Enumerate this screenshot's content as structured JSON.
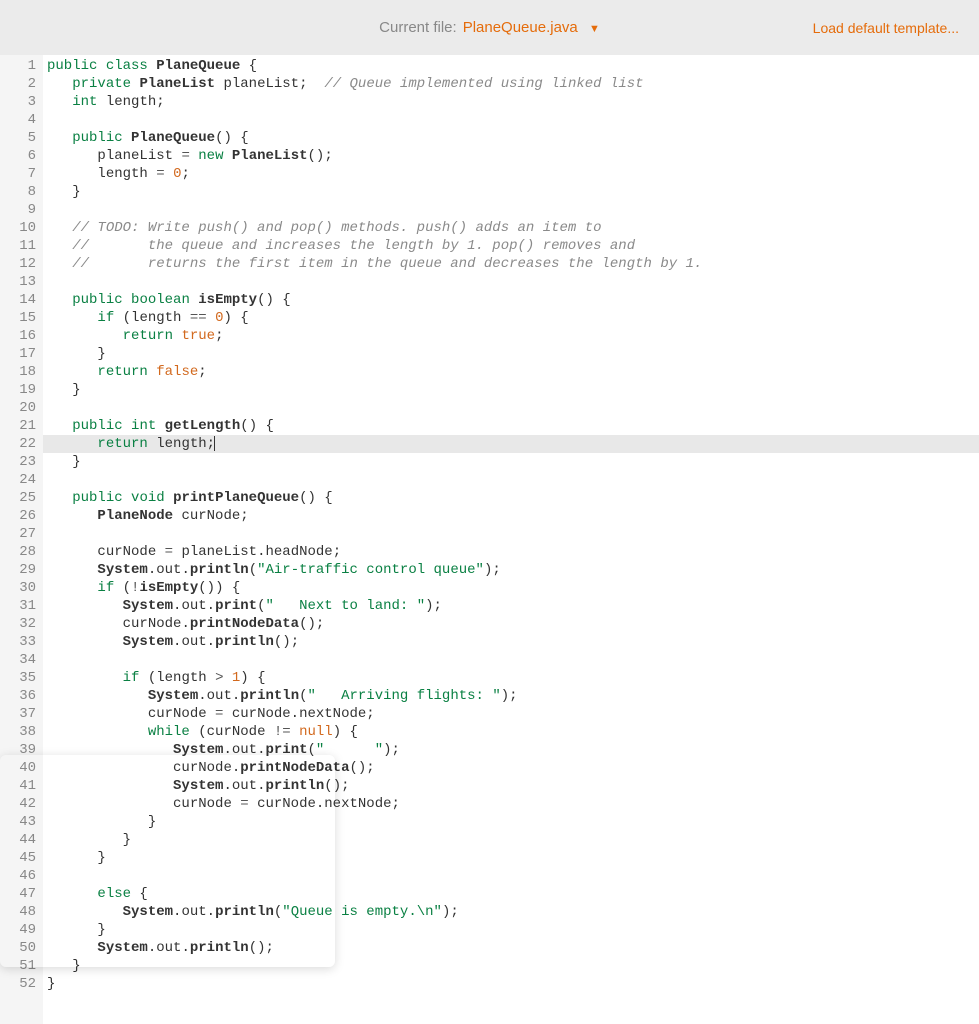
{
  "header": {
    "current_file_label": "Current file:",
    "filename": "PlaneQueue.java",
    "load_default": "Load default template..."
  },
  "active_line": 22,
  "lines": [
    [
      [
        "k-public",
        "public"
      ],
      [
        "text",
        " "
      ],
      [
        "k-class",
        "class"
      ],
      [
        "text",
        " "
      ],
      [
        "cls",
        "PlaneQueue"
      ],
      [
        "text",
        " {"
      ]
    ],
    [
      [
        "text",
        "   "
      ],
      [
        "k-private",
        "private"
      ],
      [
        "text",
        " "
      ],
      [
        "cls",
        "PlaneList"
      ],
      [
        "text",
        " "
      ],
      [
        "prop",
        "planeList"
      ],
      [
        "text",
        ";  "
      ],
      [
        "cmt",
        "// Queue implemented using linked list"
      ]
    ],
    [
      [
        "text",
        "   "
      ],
      [
        "k-int",
        "int"
      ],
      [
        "text",
        " "
      ],
      [
        "prop",
        "length"
      ],
      [
        "text",
        ";"
      ]
    ],
    [],
    [
      [
        "text",
        "   "
      ],
      [
        "k-public",
        "public"
      ],
      [
        "text",
        " "
      ],
      [
        "fn",
        "PlaneQueue"
      ],
      [
        "text",
        "() {"
      ]
    ],
    [
      [
        "text",
        "      "
      ],
      [
        "prop",
        "planeList"
      ],
      [
        "text",
        " "
      ],
      [
        "op",
        "="
      ],
      [
        "text",
        " "
      ],
      [
        "k-new",
        "new"
      ],
      [
        "text",
        " "
      ],
      [
        "cls",
        "PlaneList"
      ],
      [
        "text",
        "();"
      ]
    ],
    [
      [
        "text",
        "      "
      ],
      [
        "prop",
        "length"
      ],
      [
        "text",
        " "
      ],
      [
        "op",
        "="
      ],
      [
        "text",
        " "
      ],
      [
        "num",
        "0"
      ],
      [
        "text",
        ";"
      ]
    ],
    [
      [
        "text",
        "   }"
      ]
    ],
    [],
    [
      [
        "text",
        "   "
      ],
      [
        "cmt",
        "// TODO: Write push() and pop() methods. push() adds an item to"
      ]
    ],
    [
      [
        "text",
        "   "
      ],
      [
        "cmt",
        "//       the queue and increases the length by 1. pop() removes and"
      ]
    ],
    [
      [
        "text",
        "   "
      ],
      [
        "cmt",
        "//       returns the first item in the queue and decreases the length by 1."
      ]
    ],
    [],
    [
      [
        "text",
        "   "
      ],
      [
        "k-public",
        "public"
      ],
      [
        "text",
        " "
      ],
      [
        "k-boolean",
        "boolean"
      ],
      [
        "text",
        " "
      ],
      [
        "fn",
        "isEmpty"
      ],
      [
        "text",
        "() {"
      ]
    ],
    [
      [
        "text",
        "      "
      ],
      [
        "k-if",
        "if"
      ],
      [
        "text",
        " ("
      ],
      [
        "prop",
        "length"
      ],
      [
        "text",
        " "
      ],
      [
        "op",
        "=="
      ],
      [
        "text",
        " "
      ],
      [
        "num",
        "0"
      ],
      [
        "text",
        ") {"
      ]
    ],
    [
      [
        "text",
        "         "
      ],
      [
        "k-return",
        "return"
      ],
      [
        "text",
        " "
      ],
      [
        "k-true",
        "true"
      ],
      [
        "text",
        ";"
      ]
    ],
    [
      [
        "text",
        "      }"
      ]
    ],
    [
      [
        "text",
        "      "
      ],
      [
        "k-return",
        "return"
      ],
      [
        "text",
        " "
      ],
      [
        "k-false",
        "false"
      ],
      [
        "text",
        ";"
      ]
    ],
    [
      [
        "text",
        "   }"
      ]
    ],
    [],
    [
      [
        "text",
        "   "
      ],
      [
        "k-public",
        "public"
      ],
      [
        "text",
        " "
      ],
      [
        "k-int",
        "int"
      ],
      [
        "text",
        " "
      ],
      [
        "fn",
        "getLength"
      ],
      [
        "text",
        "() {"
      ]
    ],
    [
      [
        "text",
        "      "
      ],
      [
        "k-return",
        "return"
      ],
      [
        "text",
        " "
      ],
      [
        "prop",
        "length"
      ],
      [
        "text",
        ";"
      ]
    ],
    [
      [
        "text",
        "   }"
      ]
    ],
    [],
    [
      [
        "text",
        "   "
      ],
      [
        "k-public",
        "public"
      ],
      [
        "text",
        " "
      ],
      [
        "k-void",
        "void"
      ],
      [
        "text",
        " "
      ],
      [
        "fn",
        "printPlaneQueue"
      ],
      [
        "text",
        "() {"
      ]
    ],
    [
      [
        "text",
        "      "
      ],
      [
        "cls",
        "PlaneNode"
      ],
      [
        "text",
        " "
      ],
      [
        "prop",
        "curNode"
      ],
      [
        "text",
        ";"
      ]
    ],
    [],
    [
      [
        "text",
        "      "
      ],
      [
        "prop",
        "curNode"
      ],
      [
        "text",
        " "
      ],
      [
        "op",
        "="
      ],
      [
        "text",
        " "
      ],
      [
        "prop",
        "planeList"
      ],
      [
        "text",
        "."
      ],
      [
        "prop",
        "headNode"
      ],
      [
        "text",
        ";"
      ]
    ],
    [
      [
        "text",
        "      "
      ],
      [
        "cls",
        "System"
      ],
      [
        "text",
        "."
      ],
      [
        "prop",
        "out"
      ],
      [
        "text",
        "."
      ],
      [
        "fn",
        "println"
      ],
      [
        "text",
        "("
      ],
      [
        "str",
        "\"Air-traffic control queue\""
      ],
      [
        "text",
        ");"
      ]
    ],
    [
      [
        "text",
        "      "
      ],
      [
        "k-if",
        "if"
      ],
      [
        "text",
        " ("
      ],
      [
        "op",
        "!"
      ],
      [
        "fn",
        "isEmpty"
      ],
      [
        "text",
        "()) {"
      ]
    ],
    [
      [
        "text",
        "         "
      ],
      [
        "cls",
        "System"
      ],
      [
        "text",
        "."
      ],
      [
        "prop",
        "out"
      ],
      [
        "text",
        "."
      ],
      [
        "fn",
        "print"
      ],
      [
        "text",
        "("
      ],
      [
        "str",
        "\"   Next to land: \""
      ],
      [
        "text",
        ");"
      ]
    ],
    [
      [
        "text",
        "         "
      ],
      [
        "prop",
        "curNode"
      ],
      [
        "text",
        "."
      ],
      [
        "fn",
        "printNodeData"
      ],
      [
        "text",
        "();"
      ]
    ],
    [
      [
        "text",
        "         "
      ],
      [
        "cls",
        "System"
      ],
      [
        "text",
        "."
      ],
      [
        "prop",
        "out"
      ],
      [
        "text",
        "."
      ],
      [
        "fn",
        "println"
      ],
      [
        "text",
        "();"
      ]
    ],
    [],
    [
      [
        "text",
        "         "
      ],
      [
        "k-if",
        "if"
      ],
      [
        "text",
        " ("
      ],
      [
        "prop",
        "length"
      ],
      [
        "text",
        " "
      ],
      [
        "op",
        ">"
      ],
      [
        "text",
        " "
      ],
      [
        "num",
        "1"
      ],
      [
        "text",
        ") {"
      ]
    ],
    [
      [
        "text",
        "            "
      ],
      [
        "cls",
        "System"
      ],
      [
        "text",
        "."
      ],
      [
        "prop",
        "out"
      ],
      [
        "text",
        "."
      ],
      [
        "fn",
        "println"
      ],
      [
        "text",
        "("
      ],
      [
        "str",
        "\"   Arriving flights: \""
      ],
      [
        "text",
        ");"
      ]
    ],
    [
      [
        "text",
        "            "
      ],
      [
        "prop",
        "curNode"
      ],
      [
        "text",
        " "
      ],
      [
        "op",
        "="
      ],
      [
        "text",
        " "
      ],
      [
        "prop",
        "curNode"
      ],
      [
        "text",
        "."
      ],
      [
        "prop",
        "nextNode"
      ],
      [
        "text",
        ";"
      ]
    ],
    [
      [
        "text",
        "            "
      ],
      [
        "k-while",
        "while"
      ],
      [
        "text",
        " ("
      ],
      [
        "prop",
        "curNode"
      ],
      [
        "text",
        " "
      ],
      [
        "op",
        "!="
      ],
      [
        "text",
        " "
      ],
      [
        "k-null",
        "null"
      ],
      [
        "text",
        ") {"
      ]
    ],
    [
      [
        "text",
        "               "
      ],
      [
        "cls",
        "System"
      ],
      [
        "text",
        "."
      ],
      [
        "prop",
        "out"
      ],
      [
        "text",
        "."
      ],
      [
        "fn",
        "print"
      ],
      [
        "text",
        "("
      ],
      [
        "str",
        "\"      \""
      ],
      [
        "text",
        ");"
      ]
    ],
    [
      [
        "text",
        "               "
      ],
      [
        "prop",
        "curNode"
      ],
      [
        "text",
        "."
      ],
      [
        "fn",
        "printNodeData"
      ],
      [
        "text",
        "();"
      ]
    ],
    [
      [
        "text",
        "               "
      ],
      [
        "cls",
        "System"
      ],
      [
        "text",
        "."
      ],
      [
        "prop",
        "out"
      ],
      [
        "text",
        "."
      ],
      [
        "fn",
        "println"
      ],
      [
        "text",
        "();"
      ]
    ],
    [
      [
        "text",
        "               "
      ],
      [
        "prop",
        "curNode"
      ],
      [
        "text",
        " "
      ],
      [
        "op",
        "="
      ],
      [
        "text",
        " "
      ],
      [
        "prop",
        "curNode"
      ],
      [
        "text",
        "."
      ],
      [
        "prop",
        "nextNode"
      ],
      [
        "text",
        ";"
      ]
    ],
    [
      [
        "text",
        "            }"
      ]
    ],
    [
      [
        "text",
        "         }"
      ]
    ],
    [
      [
        "text",
        "      }"
      ]
    ],
    [],
    [
      [
        "text",
        "      "
      ],
      [
        "k-else",
        "else"
      ],
      [
        "text",
        " {"
      ]
    ],
    [
      [
        "text",
        "         "
      ],
      [
        "cls",
        "System"
      ],
      [
        "text",
        "."
      ],
      [
        "prop",
        "out"
      ],
      [
        "text",
        "."
      ],
      [
        "fn",
        "println"
      ],
      [
        "text",
        "("
      ],
      [
        "str",
        "\"Queue is empty.\\n\""
      ],
      [
        "text",
        ");"
      ]
    ],
    [
      [
        "text",
        "      }"
      ]
    ],
    [
      [
        "text",
        "      "
      ],
      [
        "cls",
        "System"
      ],
      [
        "text",
        "."
      ],
      [
        "prop",
        "out"
      ],
      [
        "text",
        "."
      ],
      [
        "fn",
        "println"
      ],
      [
        "text",
        "();"
      ]
    ],
    [
      [
        "text",
        "   }"
      ]
    ],
    [
      [
        "text",
        "}"
      ]
    ]
  ]
}
